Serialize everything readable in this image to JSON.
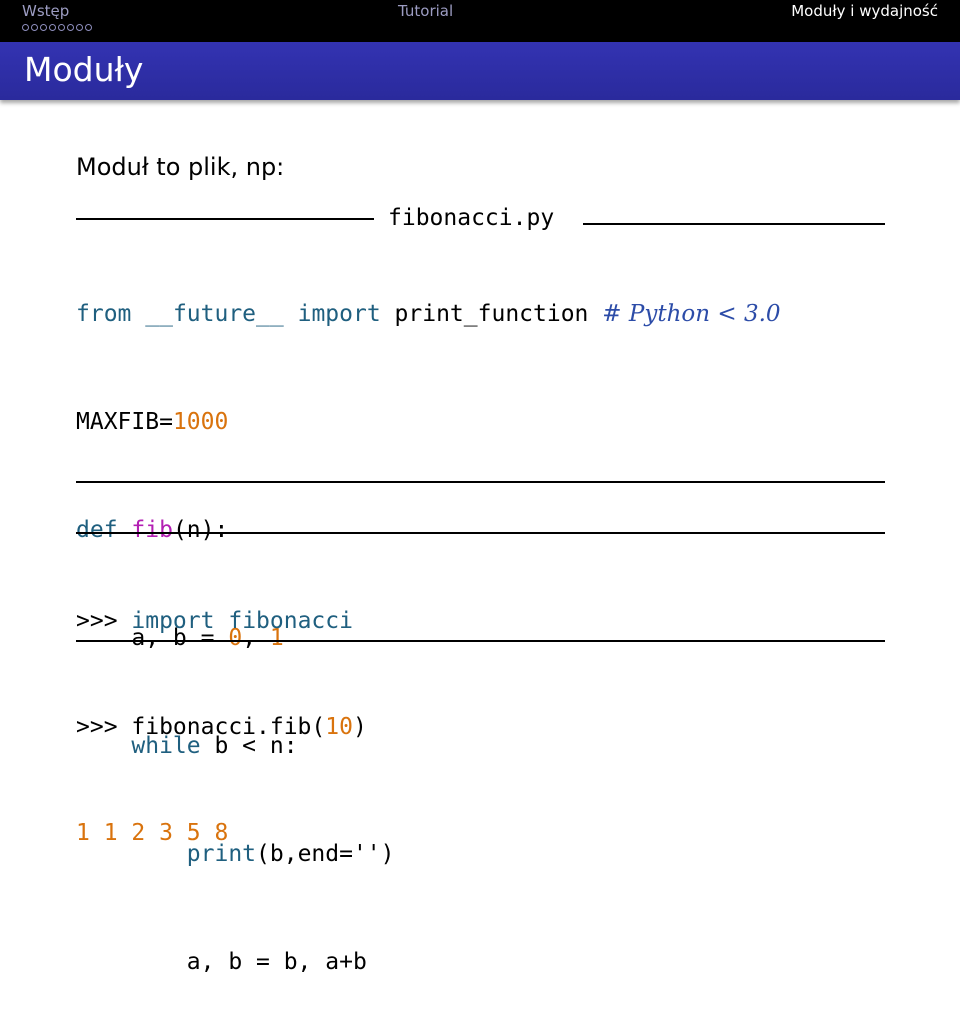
{
  "nav": {
    "left": "Wstęp",
    "center": "Tutorial",
    "right": "Moduły i wydajność",
    "dot_count": 8
  },
  "frame": {
    "title": "Moduły"
  },
  "intro": "Moduł to plik, np:",
  "file": {
    "name": "fibonacci.py",
    "line1": {
      "kw_from": "from",
      "module": "__future__",
      "kw_import": "import",
      "name": "print_function",
      "comment": "# Python < 3.0"
    },
    "line2": {
      "var": "MAXFIB=",
      "value": "1000"
    },
    "line3": {
      "kw_def": "def",
      "fname": "fib",
      "rest": "(n):"
    },
    "line4": {
      "indent": "    ",
      "lhs": "a, b = ",
      "n0": "0",
      "sep": ", ",
      "n1": "1"
    },
    "line5": {
      "indent": "    ",
      "kw_while": "while",
      "rest": " b < n:"
    },
    "line6": {
      "indent": "        ",
      "kw_print": "print",
      "args": "(b,end='')"
    },
    "line7": {
      "indent": "        ",
      "code": "a, b = b, a+b"
    }
  },
  "console": {
    "line1": {
      "prompt": ">>> ",
      "kw_import": "import",
      "module": "fibonacci"
    },
    "line2": {
      "prompt": ">>> ",
      "call": "fibonacci.fib(",
      "arg": "10",
      "close": ")"
    },
    "output": "1 1 2 3 5 8"
  },
  "colors": {
    "navbar": "#000000",
    "titlebar": "#3333b2",
    "keyword": "#1f5f7f",
    "function": "#b31fb3",
    "number": "#d9730d",
    "comment": "#2c4ca8"
  }
}
